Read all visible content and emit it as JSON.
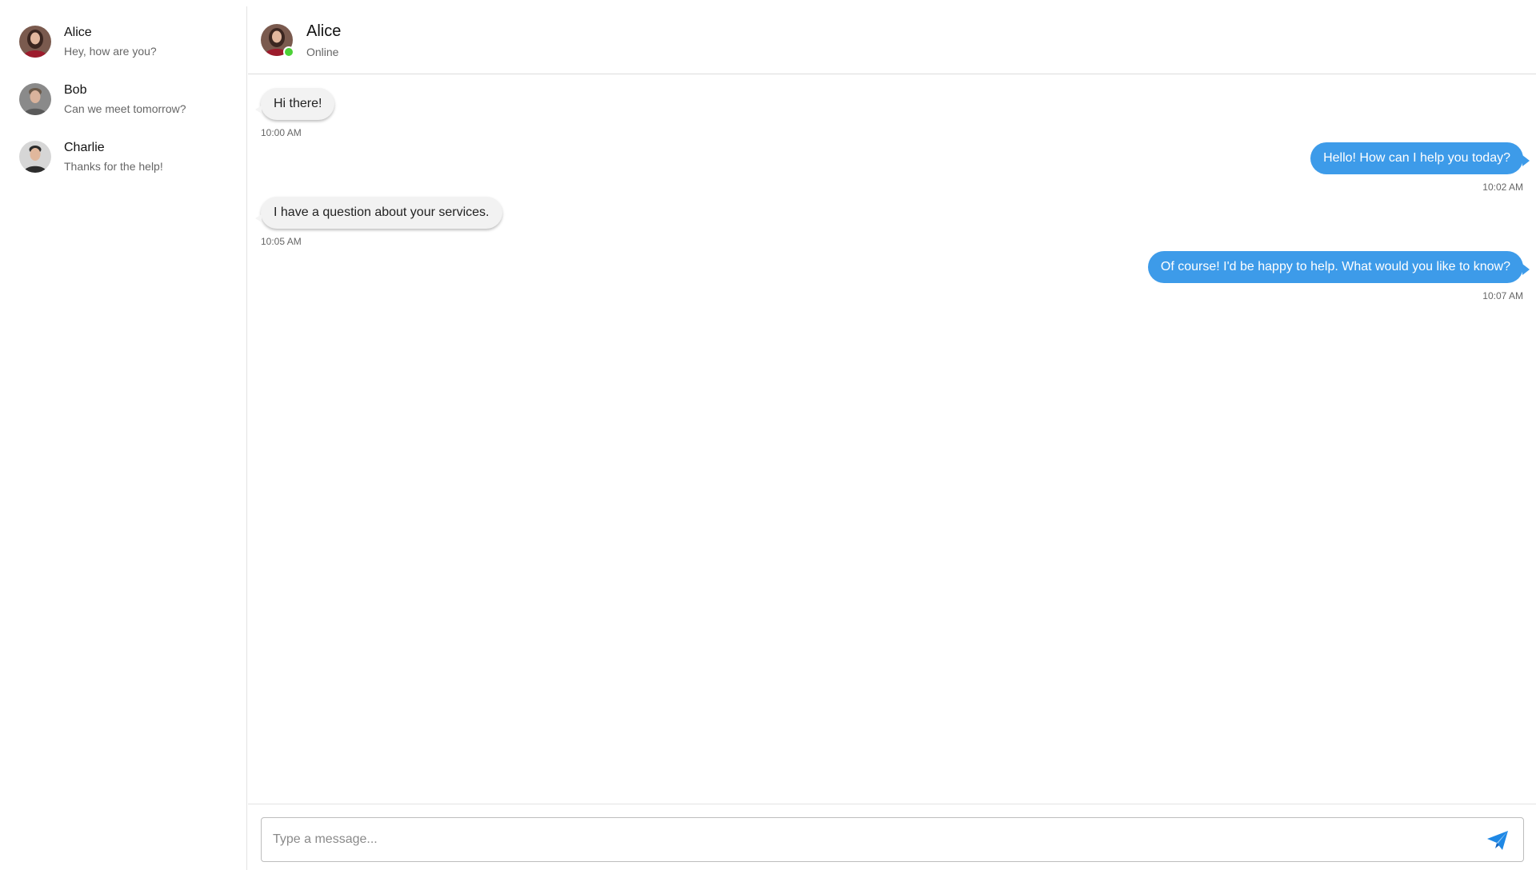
{
  "conversations": [
    {
      "name": "Alice",
      "preview": "Hey, how are you?"
    },
    {
      "name": "Bob",
      "preview": "Can we meet tomorrow?"
    },
    {
      "name": "Charlie",
      "preview": "Thanks for the help!"
    }
  ],
  "header": {
    "name": "Alice",
    "status": "Online"
  },
  "messages": [
    {
      "text": "Hi there!",
      "time": "10:00 AM",
      "direction": "incoming"
    },
    {
      "text": "Hello! How can I help you today?",
      "time": "10:02 AM",
      "direction": "outgoing"
    },
    {
      "text": "I have a question about your services.",
      "time": "10:05 AM",
      "direction": "incoming"
    },
    {
      "text": "Of course! I'd be happy to help. What would you like to know?",
      "time": "10:07 AM",
      "direction": "outgoing"
    }
  ],
  "composer": {
    "placeholder": "Type a message...",
    "value": ""
  },
  "icons": {
    "send": "send-icon",
    "online": "online-status-dot"
  },
  "colors": {
    "outgoing_bubble": "#3d9be9",
    "incoming_bubble": "#f2f2f2",
    "online": "#4cd137",
    "send_icon": "#1e88e5"
  }
}
